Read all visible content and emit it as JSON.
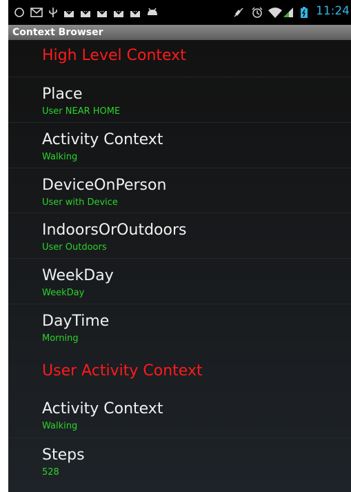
{
  "status_bar": {
    "time": "11:24",
    "icons": [
      "circle-outline-icon",
      "mail-icon",
      "usb-icon",
      "download-icon",
      "download-icon",
      "download-icon",
      "download-icon",
      "download-icon",
      "android-icon",
      "mute-icon",
      "alarm-icon",
      "wifi-icon",
      "signal-icon",
      "battery-icon"
    ]
  },
  "title_bar": {
    "title": "Context Browser"
  },
  "sections": [
    {
      "header": "High Level Context",
      "items": [
        {
          "title": "Place",
          "value": "User NEAR HOME"
        },
        {
          "title": "Activity Context",
          "value": "Walking"
        },
        {
          "title": "DeviceOnPerson",
          "value": "User with Device"
        },
        {
          "title": "IndoorsOrOutdoors",
          "value": "User Outdoors"
        },
        {
          "title": "WeekDay",
          "value": "WeekDay"
        },
        {
          "title": "DayTime",
          "value": "Morning"
        }
      ]
    },
    {
      "header": "User Activity Context",
      "items": [
        {
          "title": "Activity Context",
          "value": "Walking"
        },
        {
          "title": "Steps",
          "value": "528"
        }
      ]
    }
  ],
  "colors": {
    "header": "#ff1a1a",
    "item_title": "#f2f2f2",
    "item_value": "#2ad42a",
    "clock": "#33b5e5"
  }
}
